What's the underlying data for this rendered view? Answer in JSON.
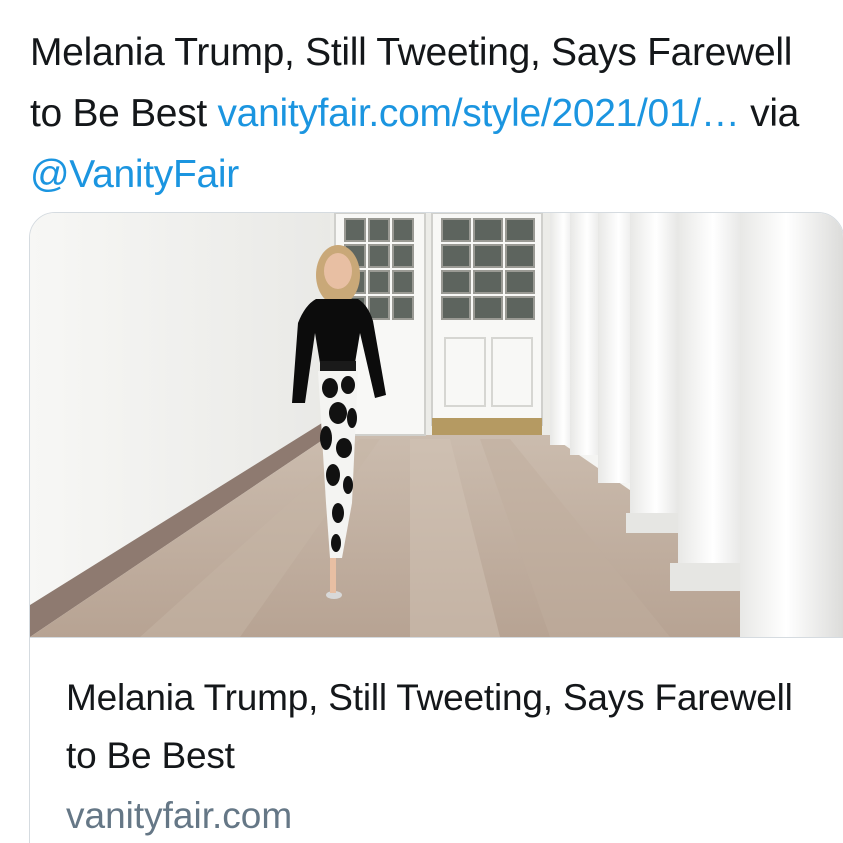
{
  "tweet": {
    "text_part1": "Melania Trump, Still Tweeting, Says Farewell to Be Best ",
    "link_text": "vanityfair.com/style/2021/01/…",
    "via_text": " via ",
    "mention": "@VanityFair",
    "link_color": "#1b95e0"
  },
  "card": {
    "image_icon": "photo-of-woman-walking-in-white-colonnade",
    "title": "Melania Trump, Still Tweeting, Says Farewell to Be Best",
    "domain": "vanityfair.com"
  }
}
